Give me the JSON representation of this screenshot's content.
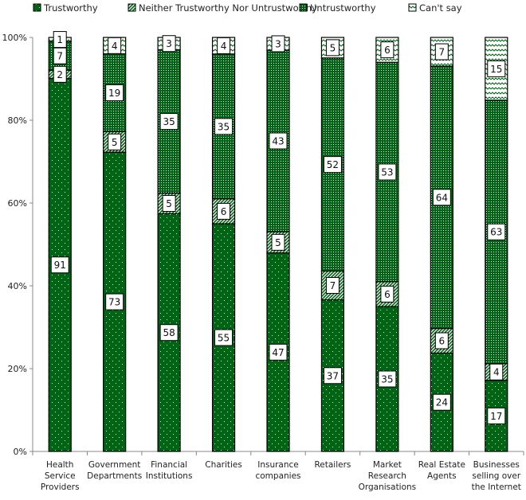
{
  "chart_data": {
    "type": "bar",
    "stacked": "percent",
    "title": "",
    "xlabel": "",
    "ylabel": "",
    "ylim": [
      0,
      100
    ],
    "yticks": [
      "0%",
      "20%",
      "40%",
      "60%",
      "80%",
      "100%"
    ],
    "grid": false,
    "legend_position": "top",
    "categories": [
      [
        "Health",
        "Service",
        "Providers"
      ],
      [
        "Government",
        "Departments"
      ],
      [
        "Financial",
        "Institutions"
      ],
      [
        "Charities"
      ],
      [
        "Insurance",
        "companies"
      ],
      [
        "Retailers"
      ],
      [
        "Market",
        "Research",
        "Organisations"
      ],
      [
        "Real Estate",
        "Agents"
      ],
      [
        "Businesses",
        "selling over",
        "the Internet"
      ]
    ],
    "series": [
      {
        "name": "Trustworthy",
        "pattern": "dots",
        "color": "#006414",
        "values": [
          91,
          73,
          58,
          55,
          47,
          37,
          35,
          24,
          17
        ]
      },
      {
        "name": "Neither Trustworthy Nor Untrustworthy",
        "pattern": "diagonal",
        "color": "#006414",
        "values": [
          2,
          5,
          5,
          6,
          5,
          7,
          6,
          6,
          4
        ]
      },
      {
        "name": "Untrustworthy",
        "pattern": "dense-dots",
        "color": "#006414",
        "values": [
          7,
          19,
          35,
          35,
          43,
          52,
          53,
          64,
          63
        ]
      },
      {
        "name": "Can't say",
        "pattern": "zigzag",
        "color": "#006414",
        "values": [
          1,
          4,
          3,
          4,
          3,
          5,
          6,
          7,
          15
        ]
      }
    ]
  }
}
